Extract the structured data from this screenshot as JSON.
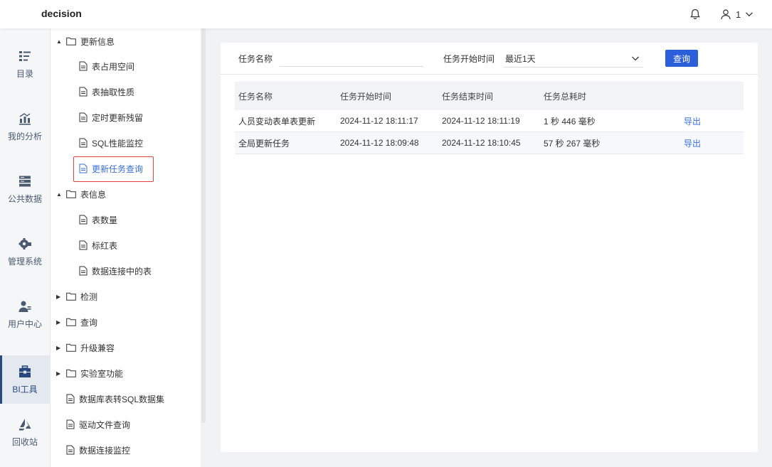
{
  "app": {
    "title": "decision",
    "user_label": "1"
  },
  "leftnav": [
    {
      "label": "目录",
      "icon": "catalog-icon"
    },
    {
      "label": "我的分析",
      "icon": "analysis-icon"
    },
    {
      "label": "公共数据",
      "icon": "database-icon"
    },
    {
      "label": "管理系统",
      "icon": "gear-icon"
    },
    {
      "label": "用户中心",
      "icon": "user-group-icon"
    },
    {
      "label": "BI工具",
      "icon": "toolbox-icon",
      "active": true
    },
    {
      "label": "回收站",
      "icon": "recycle-icon"
    }
  ],
  "tree": {
    "update_info": "更新信息",
    "update_children": [
      "表占用空间",
      "表抽取性质",
      "定时更新残留",
      "SQL性能监控",
      "更新任务查询"
    ],
    "table_info": "表信息",
    "table_children": [
      "表数量",
      "标红表",
      "数据连接中的表"
    ],
    "folders": [
      "检测",
      "查询",
      "升级兼容",
      "实验室功能"
    ],
    "files": [
      "数据库表转SQL数据集",
      "驱动文件查询",
      "数据连接监控"
    ]
  },
  "filters": {
    "task_name_label": "任务名称",
    "task_name_value": "",
    "start_time_label": "任务开始时间",
    "start_time_value": "最近1天",
    "query_button": "查询"
  },
  "table": {
    "columns": [
      "任务名称",
      "任务开始时间",
      "任务结束时间",
      "任务总耗时",
      ""
    ],
    "rows": [
      {
        "name": "人员变动表单表更新",
        "start": "2024-11-12 18:11:17",
        "end": "2024-11-12 18:11:19",
        "duration": "1 秒 446 毫秒",
        "action": "导出"
      },
      {
        "name": "全局更新任务",
        "start": "2024-11-12 18:09:48",
        "end": "2024-11-12 18:10:45",
        "duration": "57 秒 267 毫秒",
        "action": "导出"
      }
    ]
  },
  "colors": {
    "accent": "#2b5fd9",
    "link": "#3a6fd8",
    "highlight_box": "#e0443e"
  }
}
